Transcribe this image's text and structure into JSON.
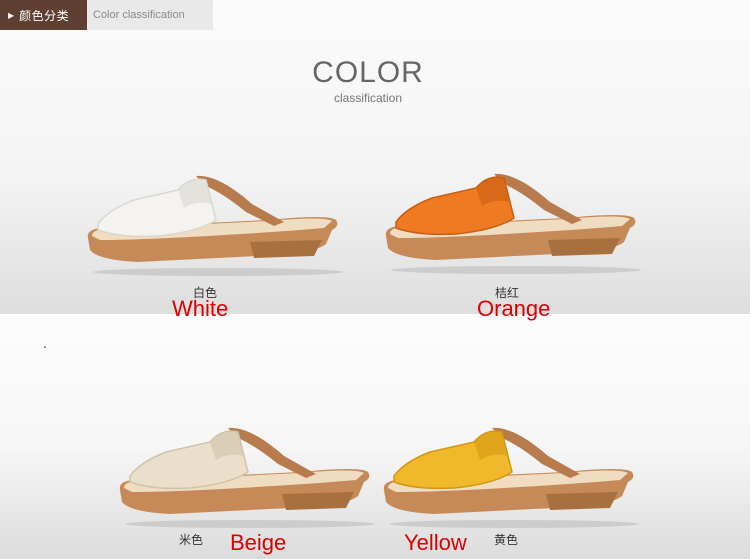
{
  "header": {
    "tag_label": "颜色分类",
    "sub_label": "Color classification"
  },
  "title": {
    "main": "COLOR",
    "sub": "classification"
  },
  "products": [
    {
      "cn_label": "白色",
      "en_label": "White",
      "strap_color": "#f4f3ef",
      "strap_shade": "#d9d7d0"
    },
    {
      "cn_label": "桔红",
      "en_label": "Orange",
      "strap_color": "#ee7a22",
      "strap_shade": "#c85e12"
    },
    {
      "cn_label": "米色",
      "en_label": "Beige",
      "strap_color": "#e9dfcb",
      "strap_shade": "#cfc3aa"
    },
    {
      "cn_label": "黄色",
      "en_label": "Yellow",
      "strap_color": "#f2b82c",
      "strap_shade": "#d39712"
    }
  ],
  "colors": {
    "label_red": "#dd0000",
    "header_brown": "#5e3f31",
    "sole": "#c68a58",
    "strap_tan": "#b77b4d"
  }
}
